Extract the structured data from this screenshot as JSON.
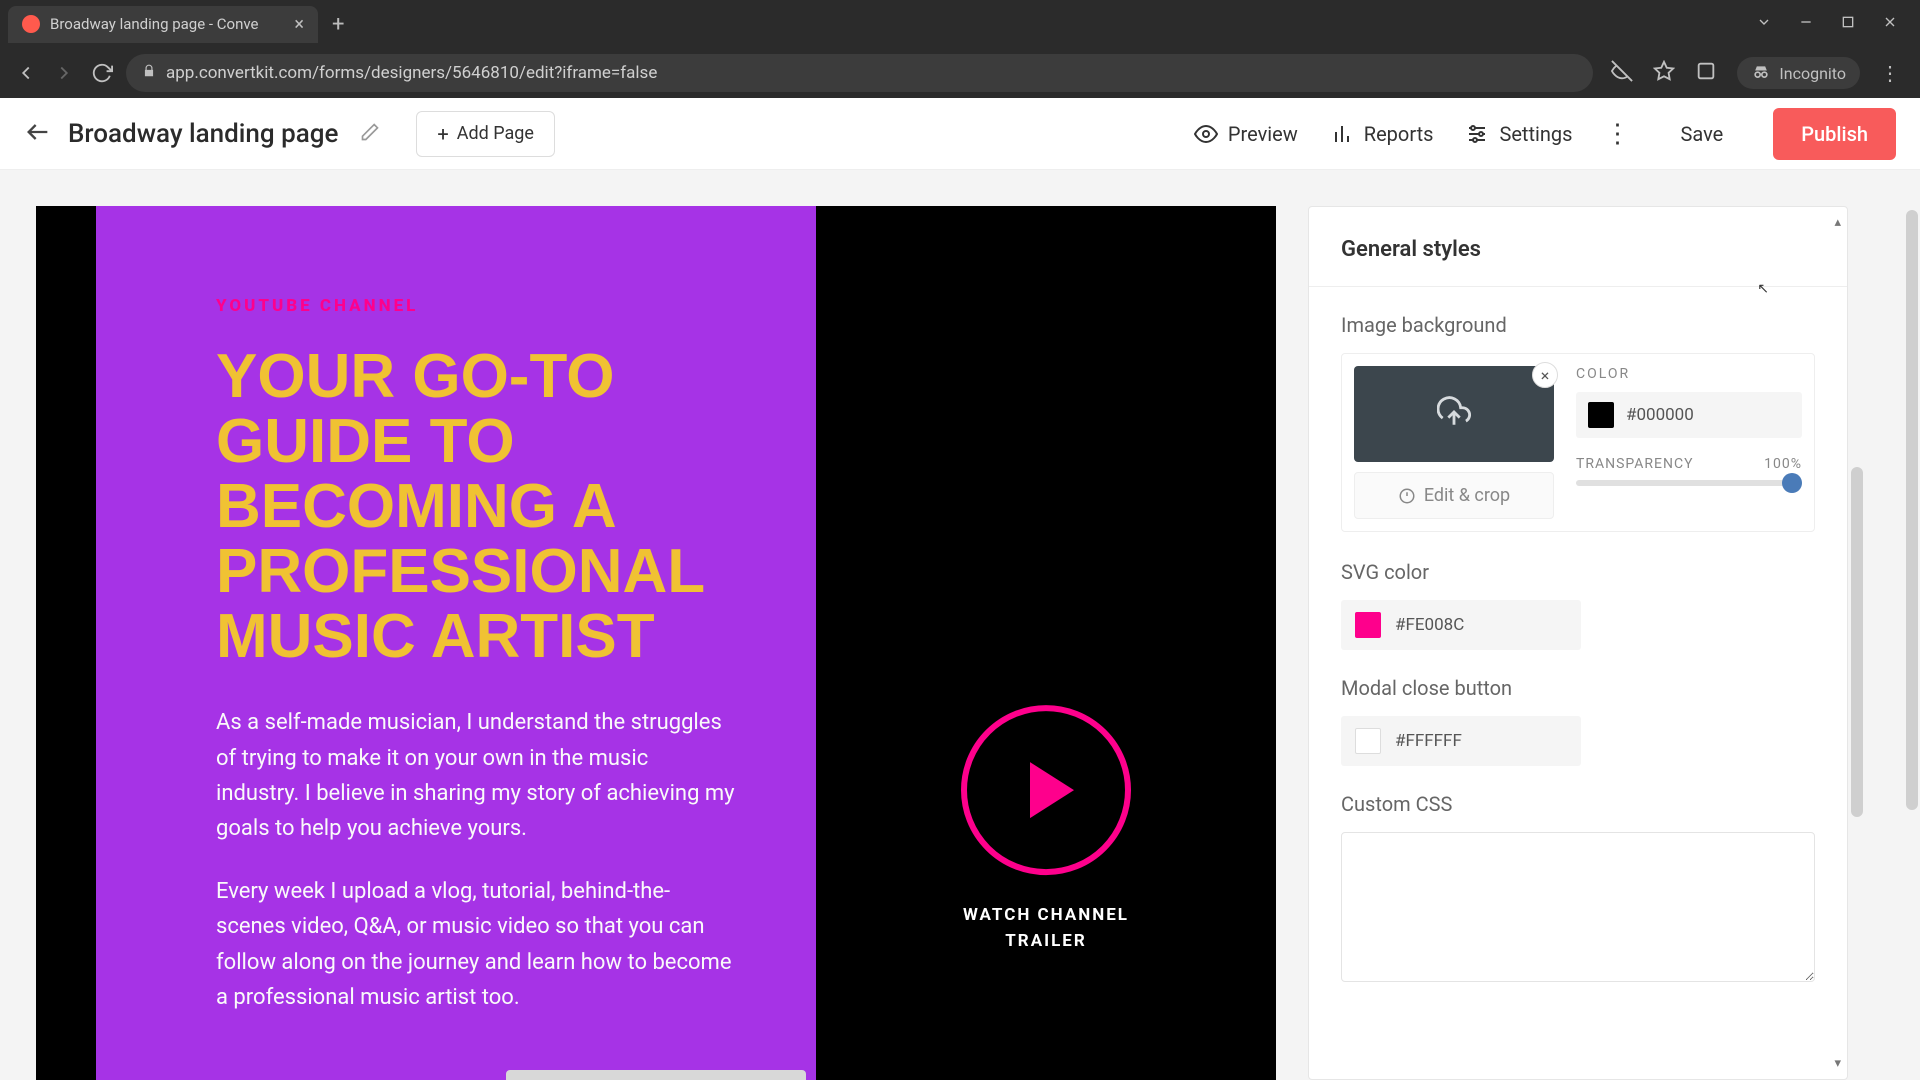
{
  "browser": {
    "tab_title": "Broadway landing page - Conve",
    "url": "app.convertkit.com/forms/designers/5646810/edit?iframe=false",
    "incognito_label": "Incognito"
  },
  "header": {
    "page_name": "Broadway landing page",
    "add_page": "Add Page",
    "preview": "Preview",
    "reports": "Reports",
    "settings": "Settings",
    "save": "Save",
    "publish": "Publish"
  },
  "canvas": {
    "eyebrow": "YOUTUBE CHANNEL",
    "title": "YOUR GO-TO GUIDE TO BECOMING A PROFESSIONAL MUSIC ARTIST",
    "p1": "As a self-made musician, I understand the struggles of trying to make it on your own in the music industry. I believe in sharing my story of achieving my goals to help you achieve yours.",
    "p2": "Every week I upload a vlog, tutorial, behind-the-scenes video, Q&A, or music video so that you can follow along on the journey and learn how to become a professional music artist too.",
    "watch_label": "WATCH CHANNEL TRAILER"
  },
  "sidebar": {
    "title": "General styles",
    "image_bg_label": "Image background",
    "color_label": "COLOR",
    "color_hex": "#000000",
    "transparency_label": "TRANSPARENCY",
    "transparency_value": "100%",
    "edit_crop": "Edit & crop",
    "svg_color_label": "SVG color",
    "svg_color_hex": "#FE008C",
    "modal_close_label": "Modal close button",
    "modal_close_hex": "#FFFFFF",
    "custom_css_label": "Custom CSS"
  },
  "colors": {
    "accent": "#fe008c",
    "hero_purple": "#a633e6",
    "hero_yellow": "#f0c233",
    "black": "#000000",
    "white": "#FFFFFF"
  }
}
